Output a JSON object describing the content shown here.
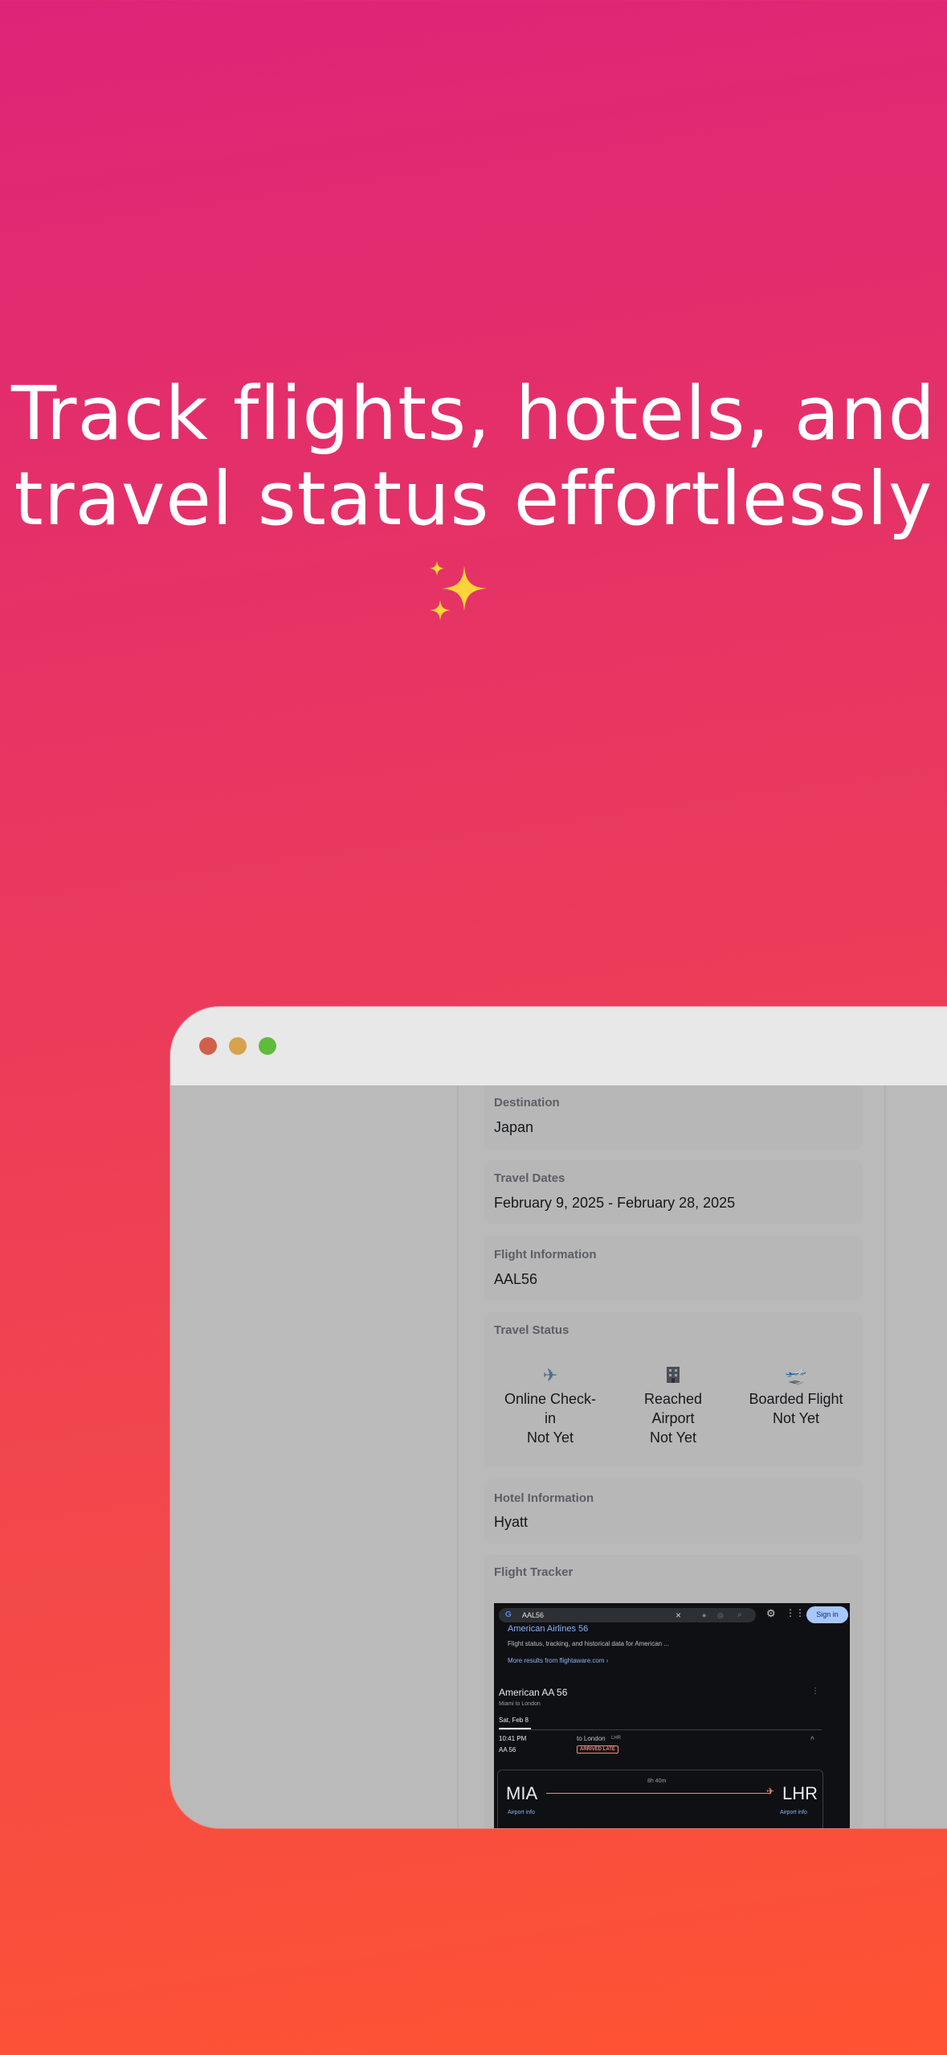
{
  "headline": {
    "line1": "Track flights, hotels, and",
    "line2": "travel status effortlessly",
    "emoji": "sparkles-icon"
  },
  "colors": {
    "gradient_top": "#de2478",
    "gradient_bottom": "#ff5331",
    "window_bar": "#e8e8e8",
    "window_body": "#bababa",
    "dot_red": "#d1604a",
    "dot_yellow": "#d6a24e",
    "dot_green": "#5fbb3b"
  },
  "cards": {
    "destination": {
      "label": "Destination",
      "value": "Japan"
    },
    "dates": {
      "label": "Travel Dates",
      "value": "February 9, 2025 - February 28, 2025"
    },
    "flight": {
      "label": "Flight Information",
      "value": "AAL56"
    },
    "status": {
      "label": "Travel Status",
      "items": [
        {
          "icon": "airplane-icon",
          "line1": "Online Check-",
          "line2": "in",
          "state": "Not Yet"
        },
        {
          "icon": "building-icon",
          "line1": "Reached",
          "line2": "Airport",
          "state": "Not Yet"
        },
        {
          "icon": "departing-plane-icon",
          "line1": "Boarded Flight",
          "line2": "",
          "state": "Not Yet"
        }
      ]
    },
    "hotel": {
      "label": "Hotel Information",
      "value": "Hyatt"
    },
    "tracker": {
      "label": "Flight Tracker"
    }
  },
  "tracker_shot": {
    "search_query": "AAL56",
    "sign_in": "Sign in",
    "result_title": "American Airlines 56",
    "result_desc": "Flight status, tracking, and historical data for American ...",
    "more_results": "More results from flightaware.com ›",
    "flight_name": "American AA 56",
    "route": "Miami to London",
    "date": "Sat, Feb 8",
    "time": "10:41 PM",
    "flight_code": "AA 56",
    "to_label": "to London",
    "to_code": "LHR",
    "status_badge": "ARRIVED LATE",
    "origin": "MIA",
    "destination": "LHR",
    "duration": "8h 40m",
    "origin_link": "Airport info",
    "dest_link": "Airport info"
  }
}
